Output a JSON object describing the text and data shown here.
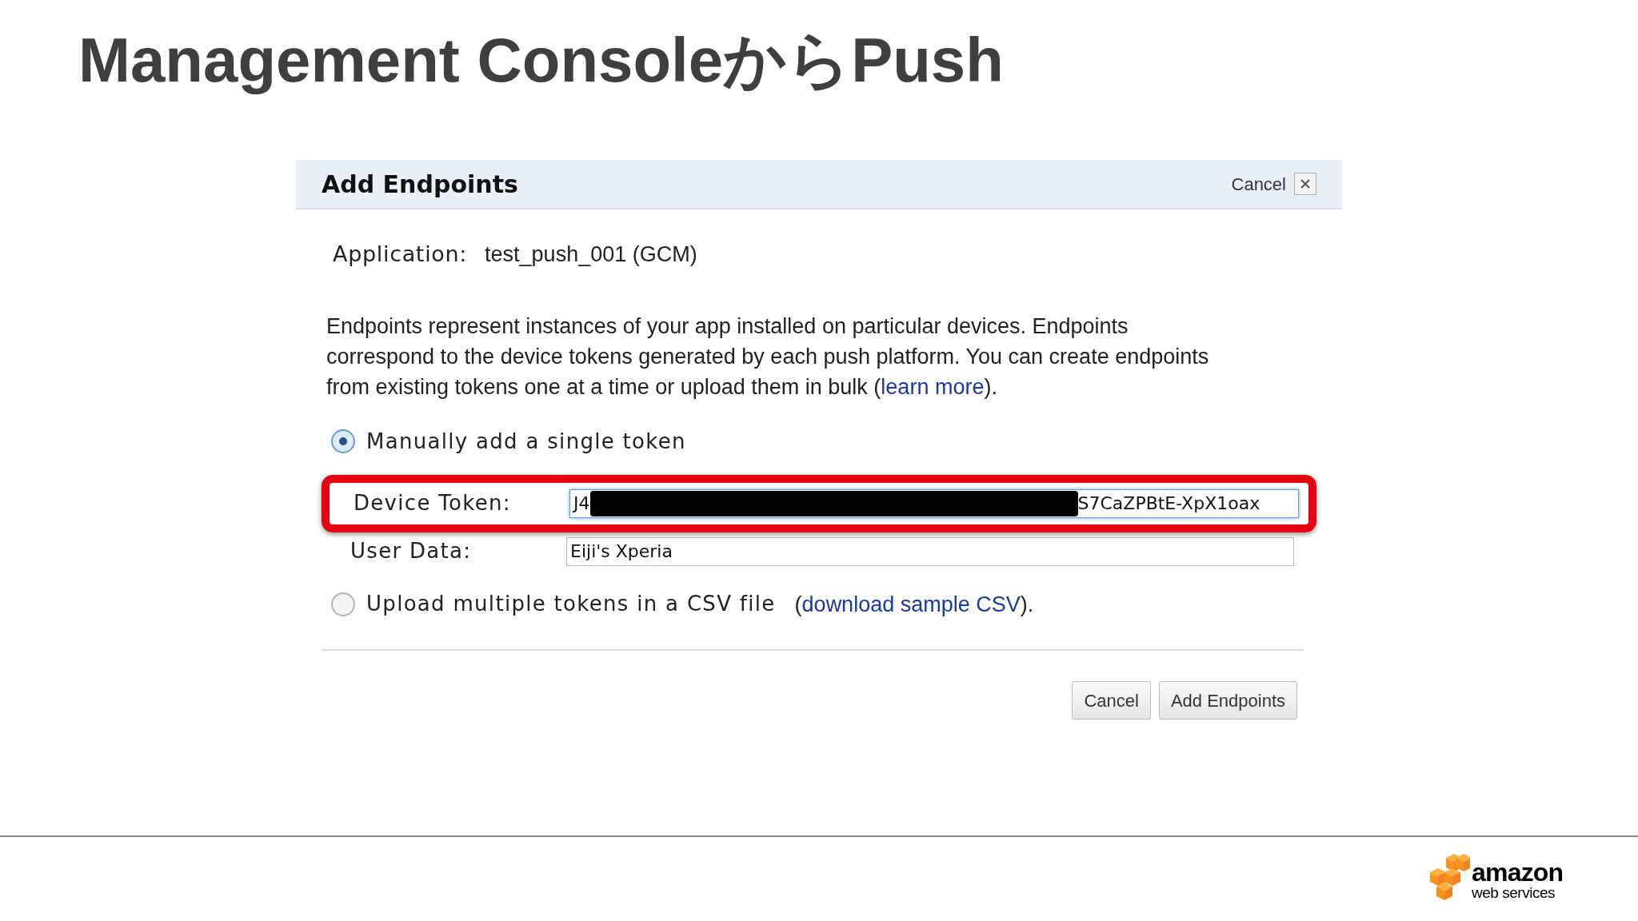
{
  "slide": {
    "title": "Management ConsoleからPush"
  },
  "dialog": {
    "title": "Add Endpoints",
    "close_label": "Cancel",
    "application": {
      "label": "Application:",
      "value": "test_push_001 (GCM)"
    },
    "description": {
      "text": "Endpoints represent instances of your app installed on particular devices. Endpoints correspond to the device tokens generated by each push platform. You can create endpoints from existing tokens one at a time or upload them in bulk (",
      "link": "learn more",
      "after": ")."
    },
    "options": [
      {
        "label": "Manually add a single token",
        "selected": true,
        "fields": [
          {
            "label": "Device Token:",
            "value_start": "J4",
            "redacted": true,
            "value_end": "S7CaZPBtE-XpX1oax",
            "focused": true,
            "highlighted": true
          },
          {
            "label": "User Data:",
            "value_start": "Eiji's Xperia",
            "redacted": false,
            "focused": false,
            "highlighted": false
          }
        ]
      },
      {
        "label": "Upload multiple tokens in a CSV file",
        "selected": false,
        "link_before": "(",
        "link": "download sample CSV",
        "link_after": ")."
      }
    ],
    "buttons": [
      "Cancel",
      "Add Endpoints"
    ]
  },
  "logo": {
    "line_1": "amazon",
    "line_2": "web services"
  }
}
